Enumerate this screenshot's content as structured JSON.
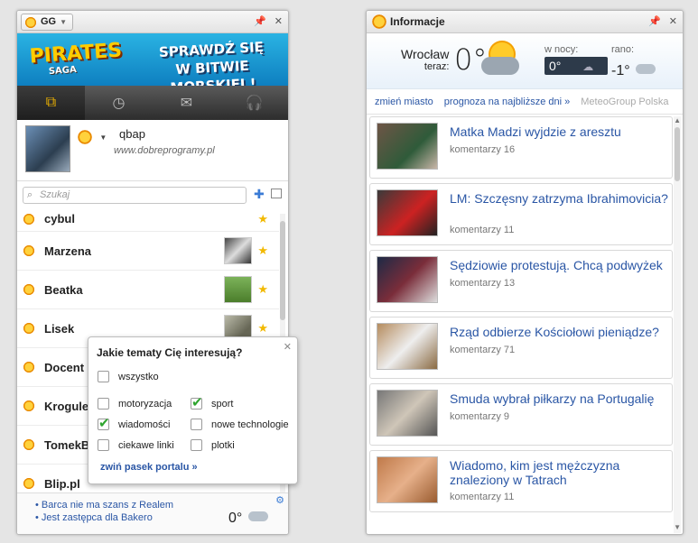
{
  "gg": {
    "app_label": "GG",
    "banner": {
      "logo": "PIRATES",
      "logo_sub": "SAGA",
      "promo_line1": "SPRAWDŹ SIĘ",
      "promo_line2": "W BITWIE MORSKIEJ !"
    },
    "tabs": [
      "contacts-icon",
      "clock-icon",
      "mail-icon",
      "headphones-icon"
    ],
    "profile": {
      "name": "qbap",
      "description": "www.dobreprogramy.pl"
    },
    "search_placeholder": "Szukaj",
    "contacts": [
      {
        "name": "cybul"
      },
      {
        "name": "Marzena"
      },
      {
        "name": "Beatka"
      },
      {
        "name": "Lisek"
      },
      {
        "name": "Docent"
      },
      {
        "name": "Krogule"
      },
      {
        "name": "TomekB"
      },
      {
        "name": "Blip.pl"
      }
    ],
    "bottom_news": [
      "Barca nie ma szans z Realem",
      "Jest zastępca dla Bakero"
    ],
    "bottom_temp": "0°",
    "popup": {
      "title": "Jakie tematy Cię interesują?",
      "options": [
        {
          "label": "wszystko",
          "checked": false
        },
        {
          "label": "motoryzacja",
          "checked": false
        },
        {
          "label": "sport",
          "checked": true
        },
        {
          "label": "wiadomości",
          "checked": true
        },
        {
          "label": "nowe technologie",
          "checked": false
        },
        {
          "label": "ciekawe linki",
          "checked": false
        },
        {
          "label": "plotki",
          "checked": false
        }
      ],
      "collapse_link": "zwiń pasek portalu »"
    }
  },
  "info": {
    "title": "Informacje",
    "weather": {
      "city": "Wrocław",
      "now_label": "teraz:",
      "now_temp": "0°",
      "night_label": "w nocy:",
      "night_temp": "0°",
      "morning_label": "rano:",
      "morning_temp": "-1°"
    },
    "links": [
      "zmień miasto",
      "prognoza na najbliższe dni »",
      "MeteoGroup Polska"
    ],
    "news": [
      {
        "title": "Matka Madzi wyjdzie z aresztu",
        "comments": "komentarzy 16"
      },
      {
        "title": "LM: Szczęsny zatrzyma Ibrahimovicia?",
        "comments": "komentarzy 11"
      },
      {
        "title": "Sędziowie protestują. Chcą podwyżek",
        "comments": "komentarzy 13"
      },
      {
        "title": "Rząd odbierze Kościołowi pieniądze?",
        "comments": "komentarzy 71"
      },
      {
        "title": "Smuda wybrał piłkarzy na Portugalię",
        "comments": "komentarzy 9"
      },
      {
        "title": "Wiadomo, kim jest mężczyzna znaleziony w Tatrach",
        "comments": "komentarzy 11"
      }
    ],
    "accent": "#2a56a5"
  }
}
